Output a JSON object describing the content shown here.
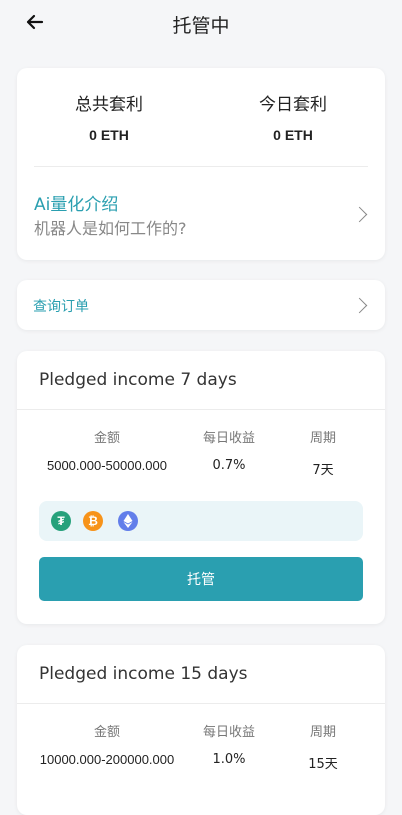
{
  "header": {
    "title": "托管中"
  },
  "stats": {
    "total_label": "总共套利",
    "total_value": "0 ETH",
    "today_label": "今日套利",
    "today_value": "0 ETH"
  },
  "ai_intro": {
    "title": "Ai量化介绍",
    "subtitle": "机器人是如何工作的?"
  },
  "query_orders": {
    "label": "查询订单"
  },
  "plans": [
    {
      "title": "Pledged income 7 days",
      "headers": [
        "金额",
        "每日收益",
        "周期"
      ],
      "amount": "5000.000-50000.000",
      "daily": "0.7%",
      "period": "7天",
      "coins": [
        "tether-icon",
        "bitcoin-icon",
        "ethereum-icon"
      ],
      "button": "托管"
    },
    {
      "title": "Pledged income 15 days",
      "headers": [
        "金额",
        "每日收益",
        "周期"
      ],
      "amount": "10000.000-200000.000",
      "daily": "1.0%",
      "period": "15天"
    }
  ],
  "colors": {
    "accent": "#2a9fb0",
    "tether": "#26a17b",
    "bitcoin": "#f7931a",
    "ethereum": "#627eea"
  }
}
